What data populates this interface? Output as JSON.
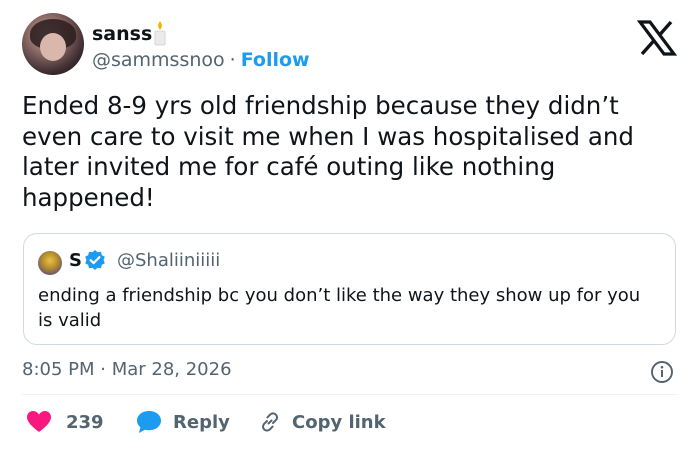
{
  "author": {
    "display_name": "sanss",
    "badge_icon": "candle-icon",
    "handle": "@sammssnoo",
    "separator": "·",
    "follow_label": "Follow"
  },
  "logo": "x-logo",
  "tweet": {
    "text": "Ended 8-9 yrs old friendship because they didn’t even care to visit me when I was hospitalised and later invited me for café outing like nothing happened!"
  },
  "quote": {
    "name": "S",
    "verified_icon": "verified-badge-icon",
    "handle": "@Shaliiniiiii",
    "text": "ending a friendship bc you don’t like the way they show up for you is valid"
  },
  "timestamp": "8:05 PM · Mar 28, 2026",
  "actions": {
    "likes_count": "239",
    "reply_label": "Reply",
    "copy_link_label": "Copy link"
  },
  "colors": {
    "accent": "#1d9bf0",
    "like": "#f91880",
    "text": "#0f1419",
    "muted": "#536471"
  }
}
